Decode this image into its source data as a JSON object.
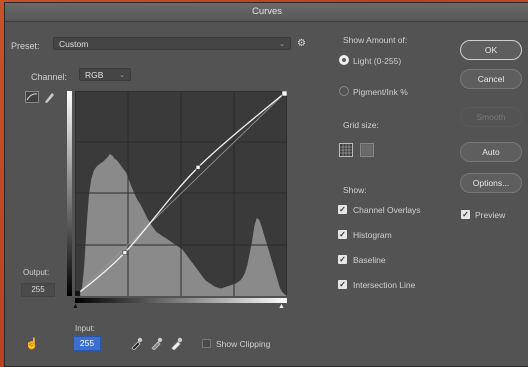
{
  "window": {
    "title": "Curves"
  },
  "preset": {
    "label": "Preset:",
    "value": "Custom"
  },
  "channel": {
    "label": "Channel:",
    "value": "RGB"
  },
  "output": {
    "label": "Output:",
    "value": "255"
  },
  "input": {
    "label": "Input:",
    "value": "255"
  },
  "show_clipping": {
    "label": "Show Clipping",
    "checked": false
  },
  "show_amount": {
    "label": "Show Amount of:",
    "options": [
      {
        "label": "Light  (0-255)",
        "selected": true
      },
      {
        "label": "Pigment/Ink %",
        "selected": false
      }
    ]
  },
  "grid_size": {
    "label": "Grid size:"
  },
  "show": {
    "label": "Show:",
    "items": [
      {
        "label": "Channel Overlays",
        "checked": true
      },
      {
        "label": "Histogram",
        "checked": true
      },
      {
        "label": "Baseline",
        "checked": true
      },
      {
        "label": "Intersection Line",
        "checked": true
      }
    ]
  },
  "buttons": {
    "ok": "OK",
    "cancel": "Cancel",
    "smooth": "Smooth",
    "auto": "Auto",
    "options": "Options..."
  },
  "preview": {
    "label": "Preview",
    "checked": true
  },
  "curve": {
    "points": [
      [
        0,
        0
      ],
      [
        60,
        54
      ],
      [
        148,
        160
      ],
      [
        255,
        255
      ]
    ],
    "histogram": [
      0,
      0,
      2,
      10,
      40,
      90,
      130,
      150,
      160,
      165,
      168,
      170,
      172,
      175,
      178,
      182,
      180,
      176,
      174,
      170,
      166,
      162,
      158,
      150,
      142,
      135,
      128,
      122,
      118,
      112,
      106,
      100,
      95,
      90,
      86,
      82,
      80,
      78,
      76,
      74,
      72,
      70,
      68,
      66,
      64,
      62,
      60,
      56,
      52,
      48,
      44,
      40,
      36,
      32,
      28,
      24,
      20,
      18,
      16,
      14,
      12,
      11,
      10,
      10,
      11,
      12,
      13,
      14,
      15,
      16,
      18,
      20,
      24,
      30,
      40,
      55,
      70,
      90,
      100,
      98,
      90,
      80,
      70,
      60,
      50,
      40,
      30,
      20,
      10,
      5,
      2,
      0
    ]
  }
}
